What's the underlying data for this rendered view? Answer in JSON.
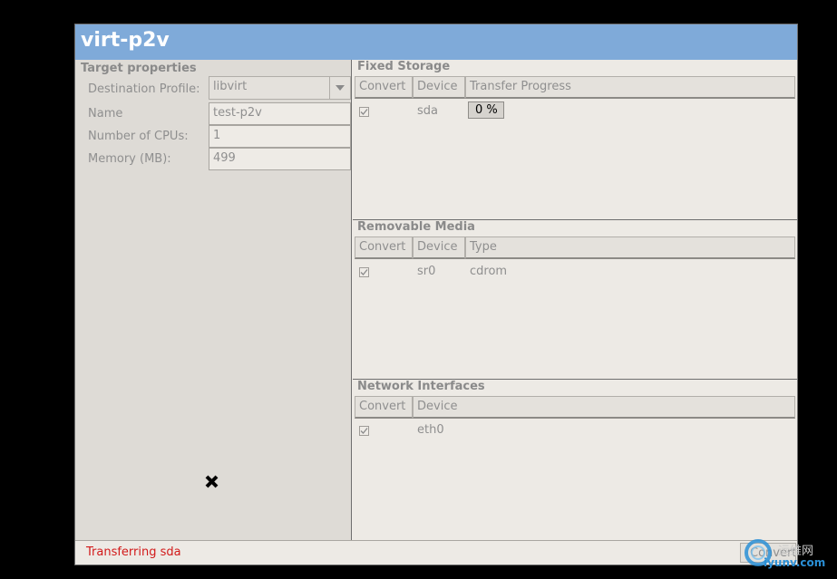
{
  "window": {
    "title": "virt-p2v"
  },
  "target_properties": {
    "frame_label": "Target properties",
    "destination_profile": {
      "label": "Destination Profile:",
      "value": "libvirt"
    },
    "name": {
      "label": "Name",
      "value": "test-p2v"
    },
    "cpus": {
      "label": "Number of CPUs:",
      "value": "1"
    },
    "memory": {
      "label": "Memory (MB):",
      "value": "499"
    }
  },
  "fixed_storage": {
    "frame_label": "Fixed Storage",
    "columns": [
      "Convert",
      "Device",
      "Transfer Progress"
    ],
    "rows": [
      {
        "convert": true,
        "device": "sda",
        "progress": "0 %",
        "progress_fraction": 0
      }
    ]
  },
  "removable_media": {
    "frame_label": "Removable Media",
    "columns": [
      "Convert",
      "Device",
      "Type"
    ],
    "rows": [
      {
        "convert": true,
        "device": "sr0",
        "type": "cdrom"
      }
    ]
  },
  "network_interfaces": {
    "frame_label": "Network Interfaces",
    "columns": [
      "Convert",
      "Device"
    ],
    "rows": [
      {
        "convert": true,
        "device": "eth0"
      }
    ]
  },
  "status": {
    "text": "Transferring sda",
    "text_color": "#d21a1a"
  },
  "buttons": {
    "convert": "Convert"
  },
  "watermark": {
    "chinese": "运维网",
    "site": "iyunv.com"
  },
  "colors": {
    "titlebar": "#7faad9",
    "window_bg": "#edeae5",
    "panel_bg": "#dedbd6"
  }
}
